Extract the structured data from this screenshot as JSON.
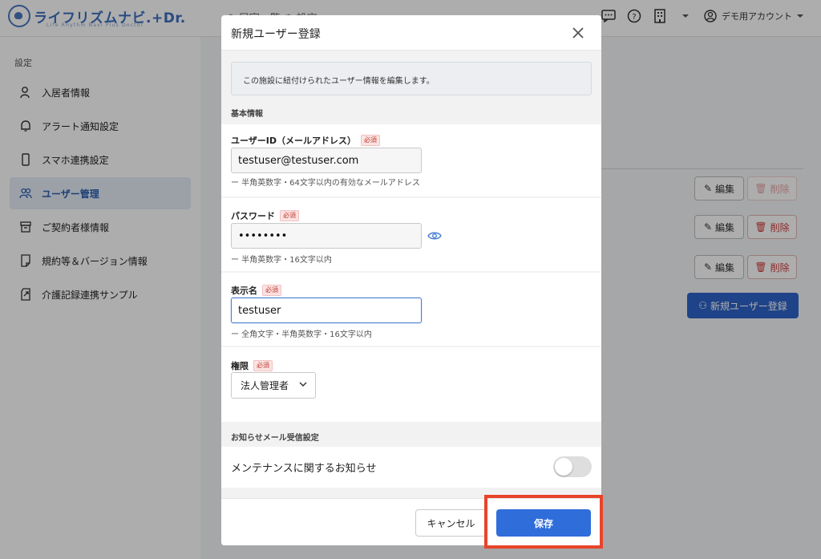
{
  "app": {
    "logo_text": "ライフリズムナビ.+Dr.",
    "logo_subtext": "Life Rhythm Navi  Plus Doctor",
    "top_nav_ghost": "☖ 居室一覧  ⚙ 設定",
    "account_name": "デモ用アカウント"
  },
  "sidebar": {
    "heading": "設定",
    "items": [
      {
        "label": "入居者情報",
        "icon": "person-icon"
      },
      {
        "label": "アラート通知設定",
        "icon": "bell-icon"
      },
      {
        "label": "スマホ連携設定",
        "icon": "smartphone-icon"
      },
      {
        "label": "ユーザー管理",
        "icon": "users-icon"
      },
      {
        "label": "ご契約者様情報",
        "icon": "archive-icon"
      },
      {
        "label": "規約等＆バージョン情報",
        "icon": "document-icon"
      },
      {
        "label": "介護記録連携サンプル",
        "icon": "export-icon"
      }
    ]
  },
  "user_table": {
    "edit_label": "編集",
    "delete_label": "削除",
    "new_user_label": "新規ユーザー登録"
  },
  "modal": {
    "title": "新規ユーザー登録",
    "info_text": "この施設に紐付けられたユーザー情報を編集します。",
    "basic_section": "基本情報",
    "required_badge": "必須",
    "user_id": {
      "label": "ユーザーID（メールアドレス）",
      "value": "testuser@testuser.com",
      "hint": "ー 半角英数字・64文字以内の有効なメールアドレス"
    },
    "password": {
      "label": "パスワード",
      "value": "testpass",
      "hint": "ー 半角英数字・16文字以内"
    },
    "display_name": {
      "label": "表示名",
      "value": "testuser",
      "hint": "ー 全角文字・半角英数字・16文字以内"
    },
    "role": {
      "label": "権限",
      "selected": "法人管理者"
    },
    "notify_section": "お知らせメール受信設定",
    "maintenance_notice": {
      "label": "メンテナンスに関するお知らせ",
      "enabled": false
    },
    "cancel_label": "キャンセル",
    "save_label": "保存"
  },
  "colors": {
    "primary": "#2f6ddb",
    "danger": "#d23b3b",
    "highlight": "#e8442a"
  }
}
